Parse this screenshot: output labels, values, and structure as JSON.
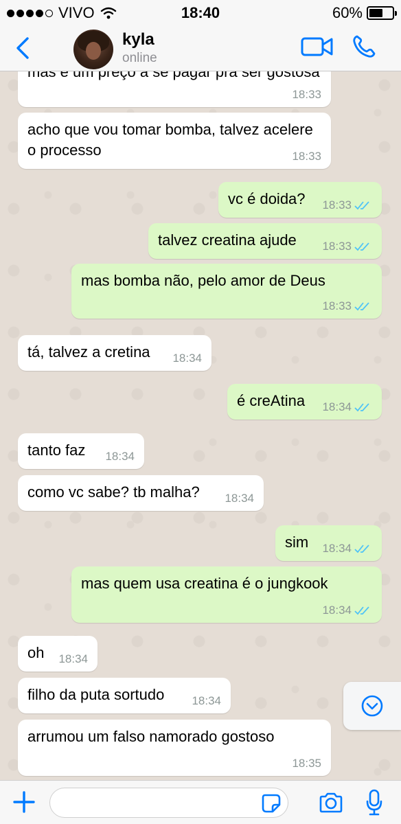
{
  "status_bar": {
    "carrier": "VIVO",
    "time": "18:40",
    "battery_percent": "60%",
    "icons": [
      "signal-dots-icon",
      "wifi-icon",
      "battery-icon"
    ]
  },
  "header": {
    "back_icon": "chevron-left-icon",
    "contact_name": "kyla",
    "contact_status": "online",
    "video_icon": "video-camera-icon",
    "call_icon": "phone-icon"
  },
  "messages": [
    {
      "dir": "in",
      "text": "mas é um preço a se pagar pra ser gostosa",
      "time": "18:33"
    },
    {
      "dir": "in",
      "text": "acho que vou tomar bomba, talvez acelere o processo",
      "time": "18:33"
    },
    {
      "dir": "out",
      "text": "vc é doida?",
      "time": "18:33"
    },
    {
      "dir": "out",
      "text": "talvez creatina ajude",
      "time": "18:33"
    },
    {
      "dir": "out",
      "text": "mas bomba não, pelo amor de Deus",
      "time": "18:33"
    },
    {
      "dir": "in",
      "text": "tá, talvez a cretina",
      "time": "18:34"
    },
    {
      "dir": "out",
      "text": "é creAtina",
      "time": "18:34"
    },
    {
      "dir": "in",
      "text": "tanto faz",
      "time": "18:34"
    },
    {
      "dir": "in",
      "text": "como vc sabe? tb malha?",
      "time": "18:34"
    },
    {
      "dir": "out",
      "text": "sim",
      "time": "18:34"
    },
    {
      "dir": "out",
      "text": "mas quem usa creatina é o jungkook",
      "time": "18:34"
    },
    {
      "dir": "in",
      "text": "oh",
      "time": "18:34"
    },
    {
      "dir": "in",
      "text": "filho da puta sortudo",
      "time": "18:34"
    },
    {
      "dir": "in",
      "text": "arrumou um falso namorado gostoso",
      "time": "18:35"
    }
  ],
  "colors": {
    "accent": "#007aff",
    "outgoing_bubble": "#dcf8c6",
    "incoming_bubble": "#ffffff",
    "chat_background": "#e5ddd5",
    "read_ticks": "#4fc3f7"
  },
  "input_bar": {
    "placeholder": "",
    "icons": [
      "plus-icon",
      "sticker-icon",
      "camera-icon",
      "microphone-icon"
    ]
  },
  "scroll_down_icon": "chevron-down-circle-icon"
}
